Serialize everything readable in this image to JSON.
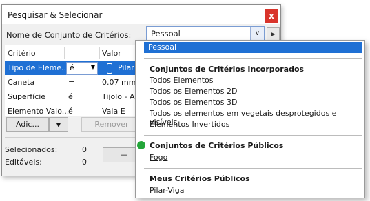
{
  "window": {
    "title": "Pesquisar & Selecionar",
    "close_glyph": "x",
    "criteria_label": "Nome de Conjunto de Critérios:",
    "criteria_value": "Pessoal",
    "criteria_dropdown_glyph": "∨",
    "next_glyph": "▶"
  },
  "table": {
    "headers": [
      "Critério",
      "Valor"
    ],
    "rows": [
      {
        "criterion": "Tipo de Eleme...",
        "operator": "é",
        "value": "Pilar",
        "selected": true
      },
      {
        "criterion": "Caneta",
        "operator": "=",
        "value": "0.07 mm",
        "selected": false
      },
      {
        "criterion": "Superfície",
        "operator": "é",
        "value": "Tijolo - Ap",
        "selected": false
      },
      {
        "criterion": "Elemento Valo...",
        "operator": "é",
        "value": "Vala E",
        "selected": false
      }
    ]
  },
  "buttons": {
    "add_label": "Adic...",
    "add_arrow": "▼",
    "remove_label": "Remover",
    "minus_label": "—"
  },
  "status": {
    "selected_label": "Selecionados:",
    "selected_count": "0",
    "editable_label": "Editáveis:",
    "editable_count": "0"
  },
  "popup": {
    "selected_item": "Pessoal",
    "sections": {
      "builtin_title": "Conjuntos de Critérios Incorporados",
      "builtin_items": [
        "Todos Elementos",
        "Todos os Elementos 2D",
        "Todos os Elementos 3D",
        "Todos os elementos em vegetais desprotegidos e visíveis",
        "Elementos Invertidos"
      ],
      "public_title": "Conjuntos de Critérios Públicos",
      "public_items": [
        "Fogo"
      ],
      "mine_title": "Meus Critérios Públicos",
      "mine_items": [
        "Pilar-Viga"
      ]
    },
    "status_dot_color": "#24a63a"
  },
  "colors": {
    "selection": "#1f70d4",
    "close": "#d9342b"
  }
}
